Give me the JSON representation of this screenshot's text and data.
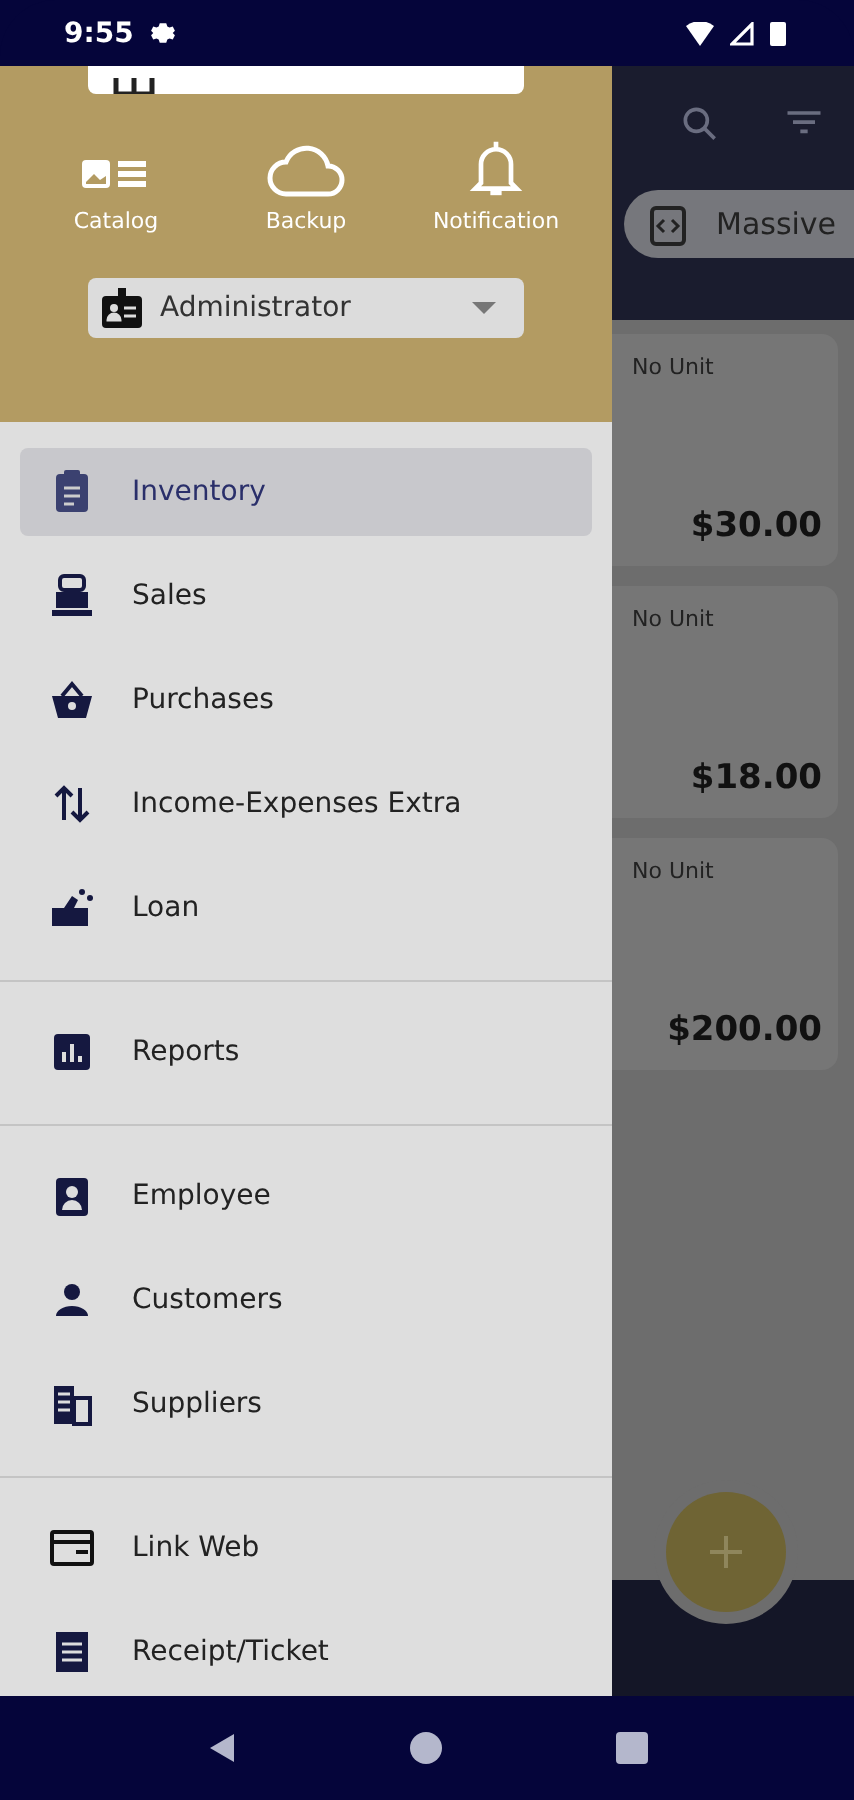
{
  "status_bar": {
    "time": "9:55"
  },
  "app_bar": {
    "chip": "Massive"
  },
  "products": [
    {
      "unit": "No Unit",
      "price": "$30.00"
    },
    {
      "unit": "No Unit",
      "price": "$18.00"
    },
    {
      "unit": "No Unit",
      "price": "$200.00"
    }
  ],
  "drawer": {
    "actions": [
      "Catalog",
      "Backup",
      "Notification"
    ],
    "role": {
      "value": "Administrator"
    },
    "sections": [
      [
        {
          "label": "Inventory",
          "selected": true
        },
        {
          "label": "Sales",
          "selected": false
        },
        {
          "label": "Purchases",
          "selected": false
        },
        {
          "label": "Income-Expenses Extra",
          "selected": false
        },
        {
          "label": "Loan",
          "selected": false
        }
      ],
      [
        {
          "label": "Reports",
          "selected": false
        }
      ],
      [
        {
          "label": "Employee",
          "selected": false
        },
        {
          "label": "Customers",
          "selected": false
        },
        {
          "label": "Suppliers",
          "selected": false
        }
      ],
      [
        {
          "label": "Link Web",
          "selected": false
        },
        {
          "label": "Receipt/Ticket",
          "selected": false
        }
      ]
    ]
  }
}
